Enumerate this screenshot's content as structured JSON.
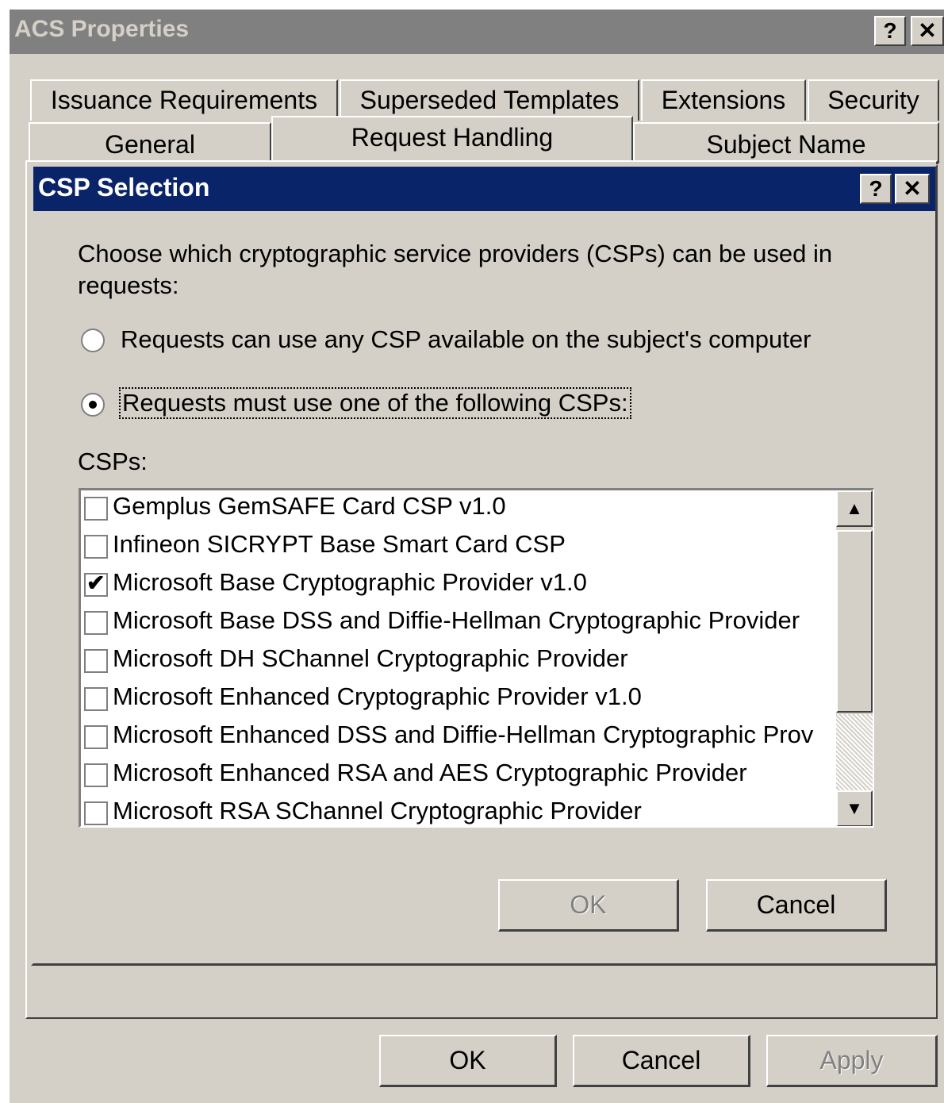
{
  "window": {
    "title": "ACS Properties",
    "help_glyph": "?",
    "close_glyph": "✕"
  },
  "tabs": {
    "row1": [
      "Issuance Requirements",
      "Superseded Templates",
      "Extensions",
      "Security"
    ],
    "row2": [
      "General",
      "Request Handling",
      "Subject Name"
    ]
  },
  "dialog": {
    "title": "CSP Selection",
    "help_glyph": "?",
    "close_glyph": "✕",
    "description_line1": "Choose which cryptographic service providers (CSPs) can be used in",
    "description_line2": "requests:",
    "radio_any": "Requests can use any CSP available on the subject's computer",
    "radio_must": "Requests must use one of the following CSPs:",
    "csps_label": "CSPs:",
    "csps": [
      {
        "label": "Gemplus GemSAFE Card CSP v1.0",
        "checked": false
      },
      {
        "label": "Infineon SICRYPT Base Smart Card CSP",
        "checked": false
      },
      {
        "label": "Microsoft Base Cryptographic Provider v1.0",
        "checked": true
      },
      {
        "label": "Microsoft Base DSS and Diffie-Hellman Cryptographic Provider",
        "checked": false
      },
      {
        "label": "Microsoft DH SChannel Cryptographic Provider",
        "checked": false
      },
      {
        "label": "Microsoft Enhanced Cryptographic Provider v1.0",
        "checked": false
      },
      {
        "label": "Microsoft Enhanced DSS and Diffie-Hellman Cryptographic Prov",
        "checked": false
      },
      {
        "label": "Microsoft Enhanced RSA and AES Cryptographic Provider",
        "checked": false
      },
      {
        "label": "Microsoft RSA SChannel Cryptographic Provider",
        "checked": false
      }
    ],
    "ok_label": "OK",
    "cancel_label": "Cancel"
  },
  "footer": {
    "ok_label": "OK",
    "cancel_label": "Cancel",
    "apply_label": "Apply"
  }
}
